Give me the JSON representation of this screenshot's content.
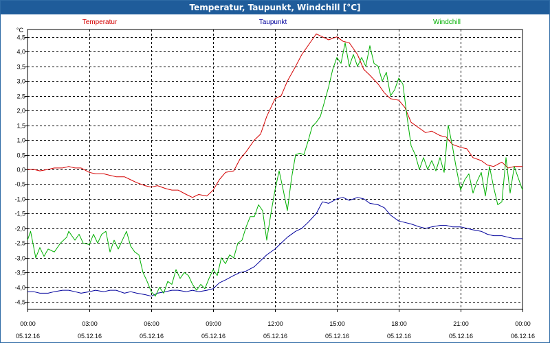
{
  "window": {
    "title": "Temperatur, Taupunkt, Windchill [°C]"
  },
  "chart_data": {
    "type": "line",
    "title": "Temperatur, Taupunkt, Windchill [°C]",
    "ylabel": "°C",
    "xlabel": "",
    "ylim": [
      -4.75,
      4.75
    ],
    "xlim": [
      0,
      24
    ],
    "grid": true,
    "legend_position": "top",
    "y_ticks": [
      4.5,
      4.0,
      3.5,
      3.0,
      2.5,
      2.0,
      1.5,
      1.0,
      0.5,
      0.0,
      -0.5,
      -1.0,
      -1.5,
      -2.0,
      -2.5,
      -3.0,
      -3.5,
      -4.0,
      -4.5
    ],
    "y_tick_labels": [
      "4,5",
      "4,0",
      "3,5",
      "3,0",
      "2,5",
      "2,0",
      "1,5",
      "1,0",
      "0,5",
      "0,0",
      "-0,5",
      "-1,0",
      "-1,5",
      "-2,0",
      "-2,5",
      "-3,0",
      "-3,5",
      "-4,0",
      "-4,5"
    ],
    "x_ticks": [
      {
        "hour": 0,
        "time": "00:00",
        "date": "05.12.16"
      },
      {
        "hour": 3,
        "time": "03:00",
        "date": "05.12.16"
      },
      {
        "hour": 6,
        "time": "06:00",
        "date": "05.12.16"
      },
      {
        "hour": 9,
        "time": "09:00",
        "date": "05.12.16"
      },
      {
        "hour": 12,
        "time": "12:00",
        "date": "05.12.16"
      },
      {
        "hour": 15,
        "time": "15:00",
        "date": "05.12.16"
      },
      {
        "hour": 18,
        "time": "18:00",
        "date": "05.12.16"
      },
      {
        "hour": 21,
        "time": "21:00",
        "date": "05.12.16"
      },
      {
        "hour": 24,
        "time": "00:00",
        "date": "06.12.16"
      }
    ],
    "series": [
      {
        "name": "Temperatur",
        "color": "#d40000",
        "points": [
          [
            0,
            0
          ],
          [
            0.3,
            0
          ],
          [
            0.6,
            -0.05
          ],
          [
            1,
            0
          ],
          [
            1.3,
            0.05
          ],
          [
            1.7,
            0.05
          ],
          [
            2,
            0.1
          ],
          [
            2.3,
            0.05
          ],
          [
            2.6,
            0.05
          ],
          [
            3,
            -0.1
          ],
          [
            3.3,
            -0.15
          ],
          [
            3.7,
            -0.15
          ],
          [
            4,
            -0.2
          ],
          [
            4.3,
            -0.25
          ],
          [
            4.7,
            -0.25
          ],
          [
            5,
            -0.35
          ],
          [
            5.3,
            -0.45
          ],
          [
            5.7,
            -0.55
          ],
          [
            6,
            -0.6
          ],
          [
            6.3,
            -0.55
          ],
          [
            6.7,
            -0.65
          ],
          [
            7,
            -0.7
          ],
          [
            7.3,
            -0.7
          ],
          [
            7.7,
            -0.85
          ],
          [
            8,
            -0.95
          ],
          [
            8.3,
            -0.85
          ],
          [
            8.7,
            -0.9
          ],
          [
            9,
            -0.7
          ],
          [
            9.3,
            -0.35
          ],
          [
            9.6,
            -0.1
          ],
          [
            10,
            -0.05
          ],
          [
            10.3,
            0.35
          ],
          [
            10.6,
            0.6
          ],
          [
            11,
            1.0
          ],
          [
            11.3,
            1.2
          ],
          [
            11.6,
            1.8
          ],
          [
            12,
            2.4
          ],
          [
            12.3,
            2.5
          ],
          [
            12.6,
            3.0
          ],
          [
            13,
            3.5
          ],
          [
            13.3,
            3.9
          ],
          [
            13.6,
            4.2
          ],
          [
            14,
            4.6
          ],
          [
            14.3,
            4.5
          ],
          [
            14.6,
            4.4
          ],
          [
            15,
            4.5
          ],
          [
            15.3,
            4.35
          ],
          [
            15.6,
            4.3
          ],
          [
            16,
            3.9
          ],
          [
            16.3,
            3.4
          ],
          [
            16.6,
            3.2
          ],
          [
            17,
            2.9
          ],
          [
            17.3,
            2.6
          ],
          [
            17.6,
            2.4
          ],
          [
            18,
            2.35
          ],
          [
            18.3,
            2.1
          ],
          [
            18.6,
            1.6
          ],
          [
            19,
            1.4
          ],
          [
            19.3,
            1.25
          ],
          [
            19.6,
            1.3
          ],
          [
            20,
            1.15
          ],
          [
            20.3,
            1.1
          ],
          [
            20.6,
            0.85
          ],
          [
            21,
            0.75
          ],
          [
            21.3,
            0.7
          ],
          [
            21.6,
            0.4
          ],
          [
            22,
            0.3
          ],
          [
            22.3,
            0.15
          ],
          [
            22.6,
            0.1
          ],
          [
            23,
            0.25
          ],
          [
            23.3,
            0.05
          ],
          [
            23.6,
            0.1
          ],
          [
            24,
            0.1
          ]
        ]
      },
      {
        "name": "Taupunkt",
        "color": "#00009c",
        "points": [
          [
            0,
            -4.15
          ],
          [
            0.3,
            -4.15
          ],
          [
            0.6,
            -4.2
          ],
          [
            1,
            -4.2
          ],
          [
            1.3,
            -4.15
          ],
          [
            1.7,
            -4.1
          ],
          [
            2,
            -4.1
          ],
          [
            2.3,
            -4.15
          ],
          [
            2.6,
            -4.2
          ],
          [
            3,
            -4.15
          ],
          [
            3.3,
            -4.1
          ],
          [
            3.7,
            -4.15
          ],
          [
            4,
            -4.1
          ],
          [
            4.3,
            -4.1
          ],
          [
            4.7,
            -4.2
          ],
          [
            5,
            -4.15
          ],
          [
            5.3,
            -4.2
          ],
          [
            5.7,
            -4.25
          ],
          [
            6,
            -4.3
          ],
          [
            6.3,
            -4.2
          ],
          [
            6.7,
            -4.15
          ],
          [
            7,
            -4.1
          ],
          [
            7.3,
            -4.1
          ],
          [
            7.7,
            -4.15
          ],
          [
            8,
            -4.1
          ],
          [
            8.3,
            -4.15
          ],
          [
            8.7,
            -4.1
          ],
          [
            9,
            -4.05
          ],
          [
            9.3,
            -3.85
          ],
          [
            9.6,
            -3.75
          ],
          [
            10,
            -3.6
          ],
          [
            10.3,
            -3.5
          ],
          [
            10.6,
            -3.45
          ],
          [
            11,
            -3.3
          ],
          [
            11.3,
            -3.1
          ],
          [
            11.6,
            -2.9
          ],
          [
            12,
            -2.7
          ],
          [
            12.3,
            -2.5
          ],
          [
            12.6,
            -2.3
          ],
          [
            13,
            -2.1
          ],
          [
            13.3,
            -2.0
          ],
          [
            13.6,
            -1.8
          ],
          [
            14,
            -1.5
          ],
          [
            14.3,
            -1.1
          ],
          [
            14.6,
            -1.15
          ],
          [
            15,
            -1.0
          ],
          [
            15.3,
            -0.95
          ],
          [
            15.6,
            -1.05
          ],
          [
            16,
            -0.95
          ],
          [
            16.3,
            -1.0
          ],
          [
            16.6,
            -1.15
          ],
          [
            17,
            -1.2
          ],
          [
            17.3,
            -1.3
          ],
          [
            17.6,
            -1.55
          ],
          [
            18,
            -1.75
          ],
          [
            18.3,
            -1.8
          ],
          [
            18.6,
            -1.85
          ],
          [
            19,
            -1.95
          ],
          [
            19.3,
            -2.0
          ],
          [
            19.6,
            -1.95
          ],
          [
            20,
            -1.9
          ],
          [
            20.3,
            -1.9
          ],
          [
            20.6,
            -1.95
          ],
          [
            21,
            -1.95
          ],
          [
            21.3,
            -2.0
          ],
          [
            21.6,
            -2.05
          ],
          [
            22,
            -2.1
          ],
          [
            22.3,
            -2.2
          ],
          [
            22.6,
            -2.25
          ],
          [
            23,
            -2.25
          ],
          [
            23.3,
            -2.3
          ],
          [
            23.6,
            -2.35
          ],
          [
            24,
            -2.35
          ]
        ]
      },
      {
        "name": "Windchill",
        "color": "#00b000",
        "points": [
          [
            0,
            -2.4
          ],
          [
            0.15,
            -2.1
          ],
          [
            0.4,
            -3.0
          ],
          [
            0.6,
            -2.65
          ],
          [
            0.8,
            -2.95
          ],
          [
            1.0,
            -2.7
          ],
          [
            1.3,
            -2.8
          ],
          [
            1.6,
            -2.5
          ],
          [
            1.9,
            -2.3
          ],
          [
            2.0,
            -2.1
          ],
          [
            2.3,
            -2.4
          ],
          [
            2.5,
            -2.2
          ],
          [
            2.7,
            -2.5
          ],
          [
            3.0,
            -2.55
          ],
          [
            3.2,
            -2.2
          ],
          [
            3.4,
            -2.5
          ],
          [
            3.6,
            -2.2
          ],
          [
            3.8,
            -2.1
          ],
          [
            4.0,
            -2.8
          ],
          [
            4.2,
            -2.4
          ],
          [
            4.4,
            -2.7
          ],
          [
            4.6,
            -2.4
          ],
          [
            4.8,
            -2.1
          ],
          [
            5.0,
            -2.6
          ],
          [
            5.2,
            -2.8
          ],
          [
            5.4,
            -2.9
          ],
          [
            5.6,
            -3.5
          ],
          [
            5.8,
            -3.8
          ],
          [
            6.0,
            -4.15
          ],
          [
            6.2,
            -4.3
          ],
          [
            6.4,
            -4.0
          ],
          [
            6.6,
            -4.2
          ],
          [
            6.8,
            -3.8
          ],
          [
            7.0,
            -3.9
          ],
          [
            7.2,
            -3.4
          ],
          [
            7.4,
            -3.7
          ],
          [
            7.6,
            -3.5
          ],
          [
            7.8,
            -3.6
          ],
          [
            8.0,
            -3.9
          ],
          [
            8.2,
            -4.1
          ],
          [
            8.4,
            -3.9
          ],
          [
            8.6,
            -4.05
          ],
          [
            8.8,
            -3.7
          ],
          [
            9.0,
            -3.4
          ],
          [
            9.2,
            -3.6
          ],
          [
            9.4,
            -3.0
          ],
          [
            9.6,
            -3.2
          ],
          [
            9.8,
            -2.9
          ],
          [
            10.0,
            -3.0
          ],
          [
            10.2,
            -2.5
          ],
          [
            10.4,
            -2.4
          ],
          [
            10.6,
            -1.95
          ],
          [
            10.8,
            -1.6
          ],
          [
            11.0,
            -1.6
          ],
          [
            11.2,
            -1.2
          ],
          [
            11.4,
            -1.4
          ],
          [
            11.6,
            -2.4
          ],
          [
            11.8,
            -1.5
          ],
          [
            12.0,
            -0.7
          ],
          [
            12.2,
            -0.05
          ],
          [
            12.4,
            -0.7
          ],
          [
            12.6,
            -1.4
          ],
          [
            12.8,
            -0.3
          ],
          [
            13.0,
            0.5
          ],
          [
            13.2,
            0.55
          ],
          [
            13.4,
            0.5
          ],
          [
            13.6,
            0.95
          ],
          [
            13.8,
            1.45
          ],
          [
            14.0,
            1.6
          ],
          [
            14.2,
            1.8
          ],
          [
            14.4,
            2.3
          ],
          [
            14.6,
            2.8
          ],
          [
            14.8,
            3.4
          ],
          [
            15.0,
            3.8
          ],
          [
            15.2,
            3.6
          ],
          [
            15.4,
            4.3
          ],
          [
            15.6,
            3.5
          ],
          [
            15.8,
            3.9
          ],
          [
            16.0,
            3.5
          ],
          [
            16.2,
            3.8
          ],
          [
            16.4,
            3.5
          ],
          [
            16.6,
            4.2
          ],
          [
            16.8,
            3.6
          ],
          [
            17.0,
            3.5
          ],
          [
            17.2,
            3.0
          ],
          [
            17.4,
            3.3
          ],
          [
            17.6,
            2.5
          ],
          [
            17.8,
            2.7
          ],
          [
            18.0,
            3.1
          ],
          [
            18.2,
            2.9
          ],
          [
            18.4,
            1.8
          ],
          [
            18.6,
            0.8
          ],
          [
            18.8,
            0.5
          ],
          [
            19.0,
            0.0
          ],
          [
            19.2,
            0.4
          ],
          [
            19.4,
            0.0
          ],
          [
            19.6,
            0.3
          ],
          [
            19.8,
            -0.05
          ],
          [
            20.0,
            0.4
          ],
          [
            20.2,
            -0.1
          ],
          [
            20.4,
            1.5
          ],
          [
            20.6,
            0.8
          ],
          [
            20.8,
            0.0
          ],
          [
            21.0,
            -0.7
          ],
          [
            21.2,
            -0.35
          ],
          [
            21.4,
            -0.15
          ],
          [
            21.6,
            -0.8
          ],
          [
            21.8,
            -0.4
          ],
          [
            22.0,
            -0.1
          ],
          [
            22.2,
            -0.9
          ],
          [
            22.4,
            0.1
          ],
          [
            22.6,
            -0.6
          ],
          [
            22.8,
            -1.2
          ],
          [
            23.0,
            -1.1
          ],
          [
            23.2,
            0.4
          ],
          [
            23.4,
            -0.8
          ],
          [
            23.6,
            0.1
          ],
          [
            23.8,
            -0.3
          ],
          [
            24.0,
            -0.7
          ]
        ]
      }
    ]
  }
}
